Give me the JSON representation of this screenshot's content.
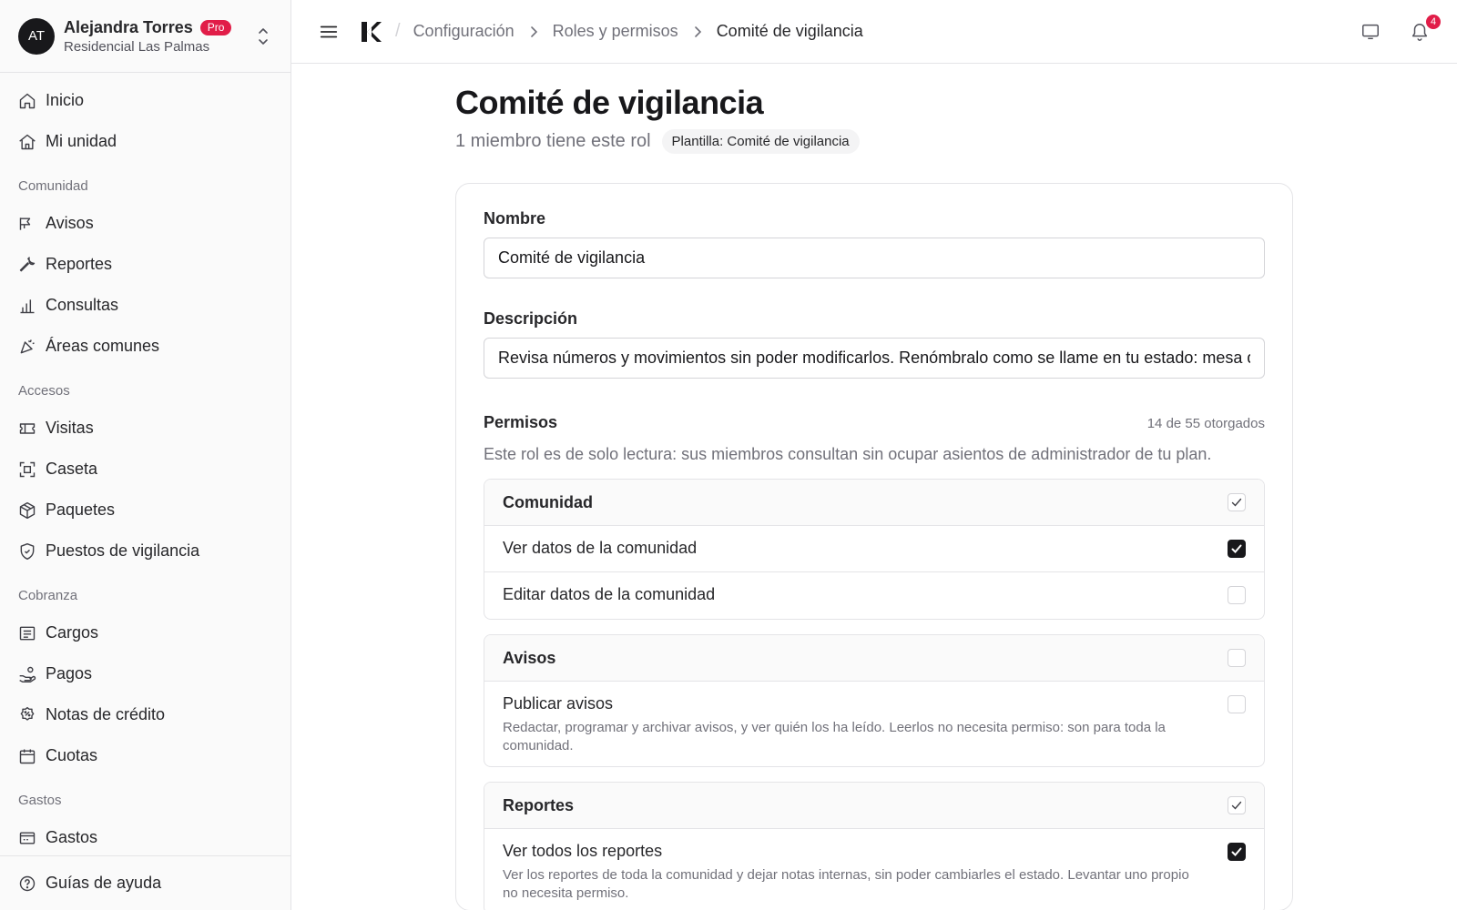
{
  "user": {
    "initials": "AT",
    "name": "Alejandra Torres",
    "plan_badge": "Pro",
    "community": "Residencial Las Palmas"
  },
  "sidebar": {
    "top_items": [
      {
        "label": "Inicio",
        "icon": "home-icon"
      },
      {
        "label": "Mi unidad",
        "icon": "house-icon"
      }
    ],
    "sections": [
      {
        "title": "Comunidad",
        "items": [
          {
            "label": "Avisos",
            "icon": "megaphone-icon"
          },
          {
            "label": "Reportes",
            "icon": "wrench-icon"
          },
          {
            "label": "Consultas",
            "icon": "bar-chart-icon"
          },
          {
            "label": "Áreas comunes",
            "icon": "party-icon"
          }
        ]
      },
      {
        "title": "Accesos",
        "items": [
          {
            "label": "Visitas",
            "icon": "ticket-icon"
          },
          {
            "label": "Caseta",
            "icon": "scan-icon"
          },
          {
            "label": "Paquetes",
            "icon": "package-icon"
          },
          {
            "label": "Puestos de vigilancia",
            "icon": "shield-icon"
          }
        ]
      },
      {
        "title": "Cobranza",
        "items": [
          {
            "label": "Cargos",
            "icon": "receipt-icon"
          },
          {
            "label": "Pagos",
            "icon": "hand-coins-icon"
          },
          {
            "label": "Notas de crédito",
            "icon": "badge-percent-icon"
          },
          {
            "label": "Cuotas",
            "icon": "calendar-icon"
          }
        ]
      },
      {
        "title": "Gastos",
        "items": [
          {
            "label": "Gastos",
            "icon": "wallet-icon"
          }
        ]
      }
    ],
    "footer": {
      "label": "Guías de ayuda",
      "icon": "help-circle-icon"
    }
  },
  "topbar": {
    "breadcrumbs": [
      "Configuración",
      "Roles y permisos",
      "Comité de vigilancia"
    ],
    "notification_count": "4"
  },
  "page": {
    "title": "Comité de vigilancia",
    "member_count": "1 miembro tiene este rol",
    "template_chip": "Plantilla: Comité de vigilancia"
  },
  "form": {
    "name_label": "Nombre",
    "name_value": "Comité de vigilancia",
    "description_label": "Descripción",
    "description_value": "Revisa números y movimientos sin poder modificarlos. Renómbralo como se llame en tu estado: mesa directiva, consejo de vigilancia…",
    "permissions_label": "Permisos",
    "permissions_count": "14 de 55 otorgados",
    "permissions_help": "Este rol es de solo lectura: sus miembros consultan sin ocupar asientos de administrador de tu plan."
  },
  "permission_groups": [
    {
      "name": "Comunidad",
      "state": "partial",
      "items": [
        {
          "label": "Ver datos de la comunidad",
          "checked": true,
          "desc": ""
        },
        {
          "label": "Editar datos de la comunidad",
          "checked": false,
          "desc": ""
        }
      ]
    },
    {
      "name": "Avisos",
      "state": "none",
      "items": [
        {
          "label": "Publicar avisos",
          "checked": false,
          "desc": "Redactar, programar y archivar avisos, y ver quién los ha leído. Leerlos no necesita permiso: son para toda la comunidad."
        }
      ]
    },
    {
      "name": "Reportes",
      "state": "partial",
      "items": [
        {
          "label": "Ver todos los reportes",
          "checked": true,
          "desc": "Ver los reportes de toda la comunidad y dejar notas internas, sin poder cambiarles el estado. Levantar uno propio no necesita permiso."
        }
      ]
    }
  ],
  "colors": {
    "accent": "#18181b",
    "badge": "#e11d48",
    "muted": "#71717a",
    "border": "#e4e4e7"
  }
}
